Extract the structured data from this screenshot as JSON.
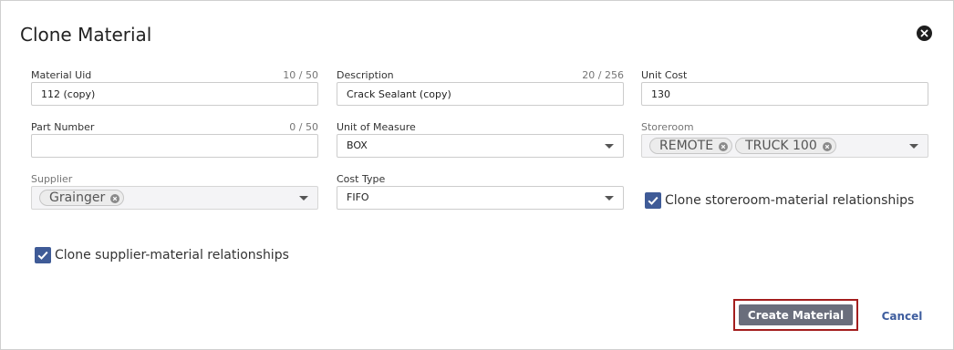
{
  "dialog": {
    "title": "Clone Material",
    "close_icon": "close-circle-icon"
  },
  "fields": {
    "material_uid": {
      "label": "Material Uid",
      "counter": "10 / 50",
      "value": "112 (copy)"
    },
    "description": {
      "label": "Description",
      "counter": "20 / 256",
      "value": "Crack Sealant (copy)"
    },
    "unit_cost": {
      "label": "Unit Cost",
      "value": "130"
    },
    "part_number": {
      "label": "Part Number",
      "counter": "0 / 50",
      "value": ""
    },
    "unit_of_measure": {
      "label": "Unit of Measure",
      "value": "BOX"
    },
    "storeroom": {
      "label": "Storeroom",
      "chips": [
        "REMOTE",
        "TRUCK 100"
      ]
    },
    "supplier": {
      "label": "Supplier",
      "chips": [
        "Grainger"
      ]
    },
    "cost_type": {
      "label": "Cost Type",
      "value": "FIFO"
    }
  },
  "checkboxes": {
    "clone_storeroom": {
      "label": "Clone storeroom-material relationships",
      "checked": true
    },
    "clone_supplier": {
      "label": "Clone supplier-material relationships",
      "checked": true
    }
  },
  "actions": {
    "create_label": "Create Material",
    "cancel_label": "Cancel"
  },
  "colors": {
    "accent": "#3f5b97",
    "primary_button": "#6a6e7c",
    "highlight_outline": "#a31d1d",
    "link": "#3e5d9e"
  }
}
